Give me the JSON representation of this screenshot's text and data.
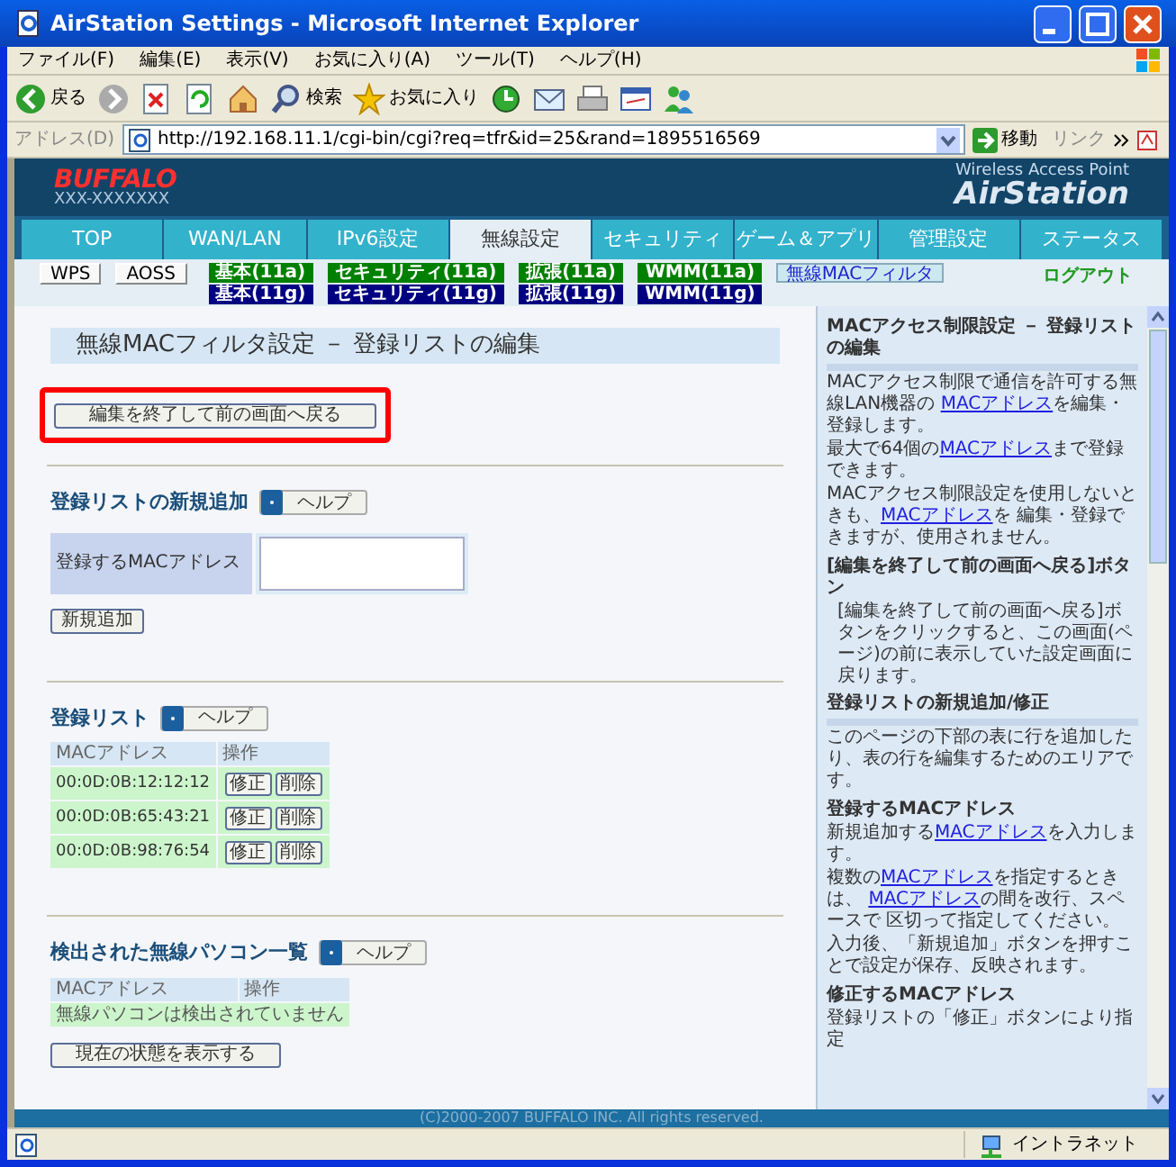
{
  "window": {
    "title": "AirStation Settings - Microsoft Internet Explorer"
  },
  "menu": [
    "ファイル(F)",
    "編集(E)",
    "表示(V)",
    "お気に入り(A)",
    "ツール(T)",
    "ヘルプ(H)"
  ],
  "toolbar": [
    {
      "kind": "back",
      "label": "戻る"
    },
    {
      "kind": "forward"
    },
    {
      "kind": "stop"
    },
    {
      "kind": "refresh"
    },
    {
      "kind": "home"
    },
    {
      "kind": "search",
      "label": "検索"
    },
    {
      "kind": "favorites",
      "label": "お気に入り"
    },
    {
      "kind": "history"
    },
    {
      "kind": "mail"
    },
    {
      "kind": "print"
    },
    {
      "kind": "edit"
    },
    {
      "kind": "messenger"
    }
  ],
  "address_bar": {
    "label": "アドレス(D)",
    "url": "http://192.168.11.1/cgi-bin/cgi?req=tfr&id=25&rand=1895516569",
    "go": "移動",
    "links": "リンク"
  },
  "header": {
    "logo": "BUFFALO",
    "model": "XXX-XXXXXXX",
    "tagline": "Wireless Access Point",
    "product": "AirStation"
  },
  "tabs": [
    {
      "label": "TOP",
      "selected": false
    },
    {
      "label": "WAN/LAN",
      "selected": false
    },
    {
      "label": "IPv6設定",
      "selected": false
    },
    {
      "label": "無線設定",
      "selected": true
    },
    {
      "label": "セキュリティ",
      "selected": false
    },
    {
      "label": "ゲーム＆アプリ",
      "selected": false
    },
    {
      "label": "管理設定",
      "selected": false
    },
    {
      "label": "ステータス",
      "selected": false
    }
  ],
  "subnav": {
    "buttons": [
      "WPS",
      "AOSS"
    ],
    "links": [
      {
        "label": "基本(11a)",
        "color": "#008000",
        "selected": false
      },
      {
        "label": "基本(11g)",
        "color": "#000080",
        "selected": false
      },
      {
        "label": "セキュリティ(11a)",
        "color": "#008000",
        "selected": false
      },
      {
        "label": "セキュリティ(11g)",
        "color": "#000080",
        "selected": false
      },
      {
        "label": "拡張(11a)",
        "color": "#008000",
        "selected": false
      },
      {
        "label": "拡張(11g)",
        "color": "#000080",
        "selected": false
      },
      {
        "label": "WMM(11a)",
        "color": "#008000",
        "selected": false
      },
      {
        "label": "WMM(11g)",
        "color": "#000080",
        "selected": false
      },
      {
        "label": "無線MACフィルタ",
        "color": "#cce8f0",
        "selected": true
      }
    ],
    "logout": "ログアウト"
  },
  "page_title": "無線MACフィルタ設定 － 登録リストの編集",
  "back_button": {
    "label": "編集を終了して前の画面へ戻る",
    "highlighted": true
  },
  "new_entry": {
    "heading": "登録リストの新規追加",
    "help": "ヘルプ",
    "field_label": "登録するMACアドレス",
    "add_button": "新規追加"
  },
  "registered": {
    "heading": "登録リスト",
    "help": "ヘルプ",
    "columns": [
      "MACアドレス",
      "操作"
    ],
    "rows": [
      {
        "mac": "00:0D:0B:12:12:12",
        "edit": "修正",
        "delete": "削除"
      },
      {
        "mac": "00:0D:0B:65:43:21",
        "edit": "修正",
        "delete": "削除"
      },
      {
        "mac": "00:0D:0B:98:76:54",
        "edit": "修正",
        "delete": "削除"
      }
    ]
  },
  "detected": {
    "heading": "検出された無線パソコン一覧",
    "help": "ヘルプ",
    "columns": [
      "MACアドレス",
      "操作"
    ],
    "empty_message": "無線パソコンは検出されていません",
    "refresh_button": "現在の状態を表示する"
  },
  "help_panel": [
    {
      "kind": "heading",
      "segments": [
        {
          "text": "MACアクセス制限設定 － 登録リストの編集",
          "link": false
        }
      ]
    },
    {
      "kind": "text",
      "segments": [
        {
          "text": "MACアクセス制限で通信を許可する無線LAN機器の ",
          "link": false
        },
        {
          "text": "MACアドレス",
          "link": true
        },
        {
          "text": "を編集・登録します。",
          "link": false
        }
      ]
    },
    {
      "kind": "text",
      "segments": [
        {
          "text": "最大で64個の",
          "link": false
        },
        {
          "text": "MACアドレス",
          "link": true
        },
        {
          "text": "まで登録できます。",
          "link": false
        }
      ]
    },
    {
      "kind": "text",
      "segments": [
        {
          "text": "MACアクセス制限設定を使用しないときも、",
          "link": false
        },
        {
          "text": "MACアドレス",
          "link": true
        },
        {
          "text": "を 編集・登録できますが、使用されません。",
          "link": false
        }
      ]
    },
    {
      "kind": "subheading",
      "segments": [
        {
          "text": "[編集を終了して前の画面へ戻る]ボタン",
          "link": false
        }
      ]
    },
    {
      "kind": "indented",
      "segments": [
        {
          "text": "[編集を終了して前の画面へ戻る]ボタンをクリックすると、この画面(ページ)の前に表示していた設定画面に戻ります。",
          "link": false
        }
      ]
    },
    {
      "kind": "heading",
      "segments": [
        {
          "text": "登録リストの新規追加/修正",
          "link": false
        }
      ]
    },
    {
      "kind": "text",
      "segments": [
        {
          "text": "このページの下部の表に行を追加したり、表の行を編集するためのエリアです。",
          "link": false
        }
      ]
    },
    {
      "kind": "subheading",
      "segments": [
        {
          "text": "登録するMACアドレス",
          "link": false
        }
      ]
    },
    {
      "kind": "text",
      "segments": [
        {
          "text": "新規追加する",
          "link": false
        },
        {
          "text": "MACアドレス",
          "link": true
        },
        {
          "text": "を入力します。",
          "link": false
        }
      ]
    },
    {
      "kind": "text",
      "segments": [
        {
          "text": "複数の",
          "link": false
        },
        {
          "text": "MACアドレス",
          "link": true
        },
        {
          "text": "を指定するときは、 ",
          "link": false
        },
        {
          "text": "MACアドレス",
          "link": true
        },
        {
          "text": "の間を改行、スペースで 区切って指定してください。",
          "link": false
        }
      ]
    },
    {
      "kind": "text",
      "segments": [
        {
          "text": "入力後、「新規追加」ボタンを押すことで設定が保存、反映されます。",
          "link": false
        }
      ]
    },
    {
      "kind": "subheading",
      "segments": [
        {
          "text": "修正するMACアドレス",
          "link": false
        }
      ]
    },
    {
      "kind": "text",
      "segments": [
        {
          "text": "登録リストの「修正」ボタンにより指定",
          "link": false
        }
      ]
    }
  ],
  "footer": "(C)2000-2007 BUFFALO INC. All rights reserved.",
  "status_bar": {
    "zone": "イントラネット"
  }
}
